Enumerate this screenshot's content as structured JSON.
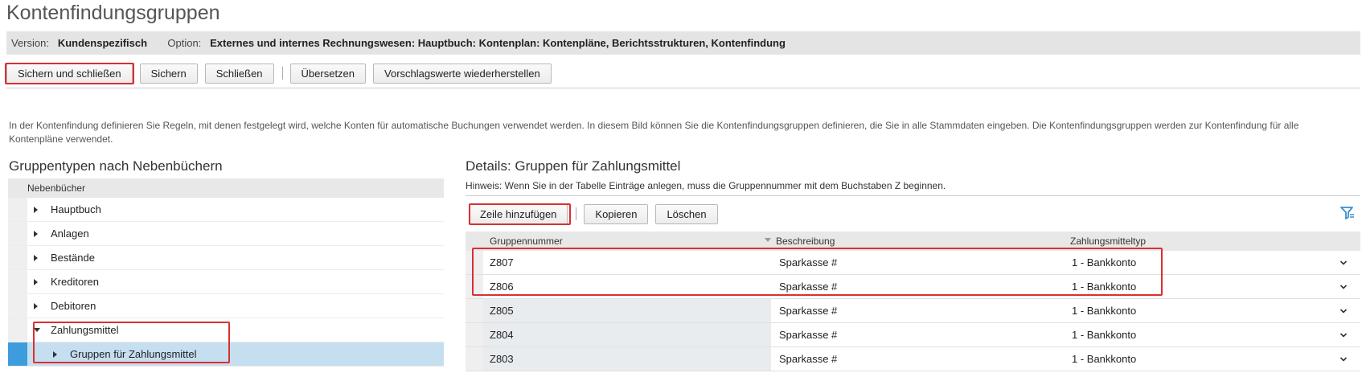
{
  "page": {
    "title": "Kontenfindungsgruppen"
  },
  "info_bar": {
    "version_label": "Version:",
    "version_value": "Kundenspezifisch",
    "option_label": "Option:",
    "option_value": "Externes und internes Rechnungswesen: Hauptbuch: Kontenplan: Kontenpläne, Berichtsstrukturen, Kontenfindung"
  },
  "toolbar": {
    "save_close_label": "Sichern und schließen",
    "save_label": "Sichern",
    "close_label": "Schließen",
    "translate_label": "Übersetzen",
    "restore_label": "Vorschlagswerte wiederherstellen"
  },
  "description": "In der Kontenfindung definieren Sie Regeln, mit denen festgelegt wird, welche Konten für automatische Buchungen verwendet werden. In diesem Bild können Sie die Kontenfindungsgruppen definieren, die Sie in alle Stammdaten eingeben. Die Kontenfindungsgruppen werden zur Kontenfindung für alle Kontenpläne verwendet.",
  "left_panel": {
    "title": "Gruppentypen nach Nebenbüchern",
    "column_header": "Nebenbücher",
    "items": [
      {
        "label": "Hauptbuch"
      },
      {
        "label": "Anlagen"
      },
      {
        "label": "Bestände"
      },
      {
        "label": "Kreditoren"
      },
      {
        "label": "Debitoren"
      },
      {
        "label": "Zahlungsmittel"
      },
      {
        "label": "Gruppen für Zahlungsmittel"
      }
    ]
  },
  "details": {
    "title": "Details: Gruppen für Zahlungsmittel",
    "hint": "Hinweis: Wenn Sie in der Tabelle Einträge anlegen, muss die Gruppennummer mit dem Buchstaben Z beginnen.",
    "toolbar": {
      "add_row_label": "Zeile hinzufügen",
      "copy_label": "Kopieren",
      "delete_label": "Löschen"
    },
    "columns": [
      "Gruppennummer",
      "Beschreibung",
      "Zahlungsmitteltyp"
    ],
    "rows": [
      {
        "group": "Z807",
        "description": "Sparkasse #",
        "type": "1 - Bankkonto"
      },
      {
        "group": "Z806",
        "description": "Sparkasse #",
        "type": "1 - Bankkonto"
      },
      {
        "group": "Z805",
        "description": "Sparkasse #",
        "type": "1 - Bankkonto"
      },
      {
        "group": "Z804",
        "description": "Sparkasse #",
        "type": "1 - Bankkonto"
      },
      {
        "group": "Z803",
        "description": "Sparkasse #",
        "type": "1 - Bankkonto"
      }
    ]
  },
  "colors": {
    "highlight": "#d93030",
    "selection": "#c6dff0",
    "selection_marker": "#3c9cdc",
    "filter_icon": "#3a8fd0"
  }
}
